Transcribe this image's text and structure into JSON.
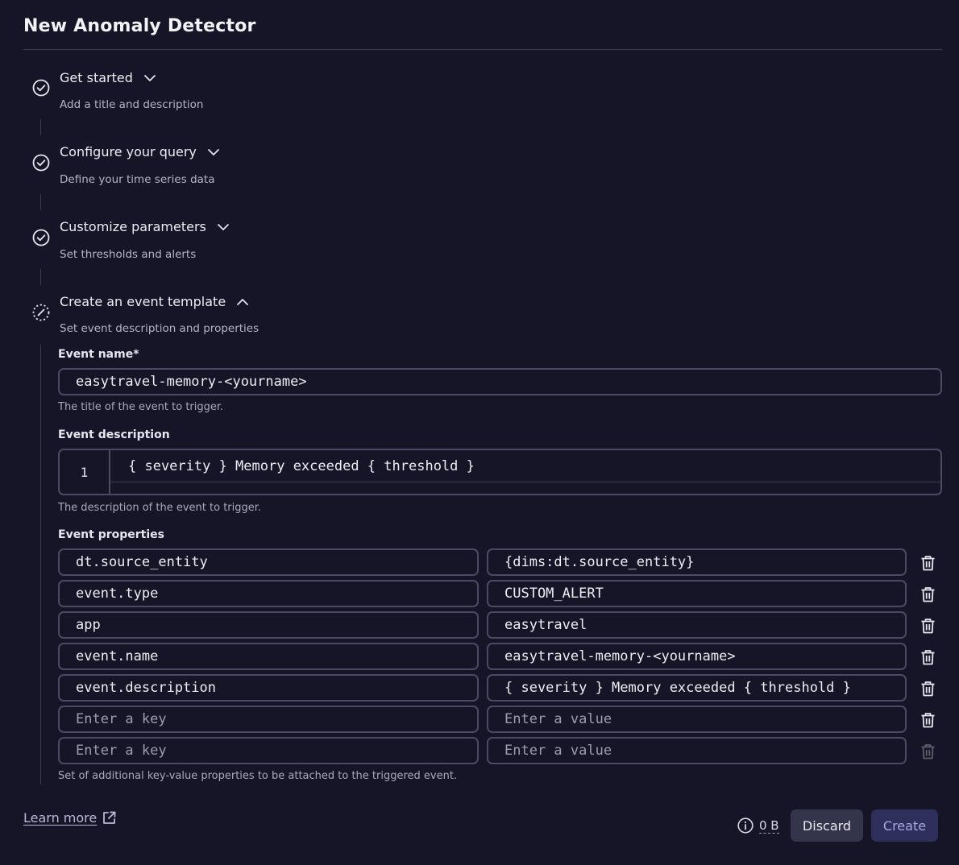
{
  "page": {
    "title": "New Anomaly Detector"
  },
  "steps": [
    {
      "title": "Get started",
      "subtitle": "Add a title and description",
      "status": "complete",
      "expanded": false
    },
    {
      "title": "Configure your query",
      "subtitle": "Define your time series data",
      "status": "complete",
      "expanded": false
    },
    {
      "title": "Customize parameters",
      "subtitle": "Set thresholds and alerts",
      "status": "complete",
      "expanded": false
    },
    {
      "title": "Create an event template",
      "subtitle": "Set event description and properties",
      "status": "in-progress",
      "expanded": true
    }
  ],
  "event_template": {
    "name_label": "Event name*",
    "name_value": "easytravel-memory-<yourname>",
    "name_helper": "The title of the event to trigger.",
    "description_label": "Event description",
    "description_line_number": "1",
    "description_value": "{ severity } Memory exceeded { threshold }",
    "description_helper": "The description of the event to trigger.",
    "properties_label": "Event properties",
    "properties": [
      {
        "key": "dt.source_entity",
        "value": "{dims:dt.source_entity}"
      },
      {
        "key": "event.type",
        "value": "CUSTOM_ALERT"
      },
      {
        "key": "app",
        "value": "easytravel"
      },
      {
        "key": "event.name",
        "value": "easytravel-memory-<yourname>"
      },
      {
        "key": "event.description",
        "value": "{ severity } Memory exceeded { threshold }"
      },
      {
        "key": "",
        "value": ""
      },
      {
        "key": "",
        "value": ""
      }
    ],
    "key_placeholder": "Enter a key",
    "value_placeholder": "Enter a value",
    "properties_helper": "Set of additional key-value properties to be attached to the triggered event."
  },
  "footer": {
    "learn_more": "Learn more",
    "size_value": "0 B",
    "discard_label": "Discard",
    "create_label": "Create"
  },
  "colors": {
    "background": "#151527",
    "border": "#4a4a62",
    "create_bg": "#2f2f5c",
    "discard_bg": "#34344a"
  }
}
